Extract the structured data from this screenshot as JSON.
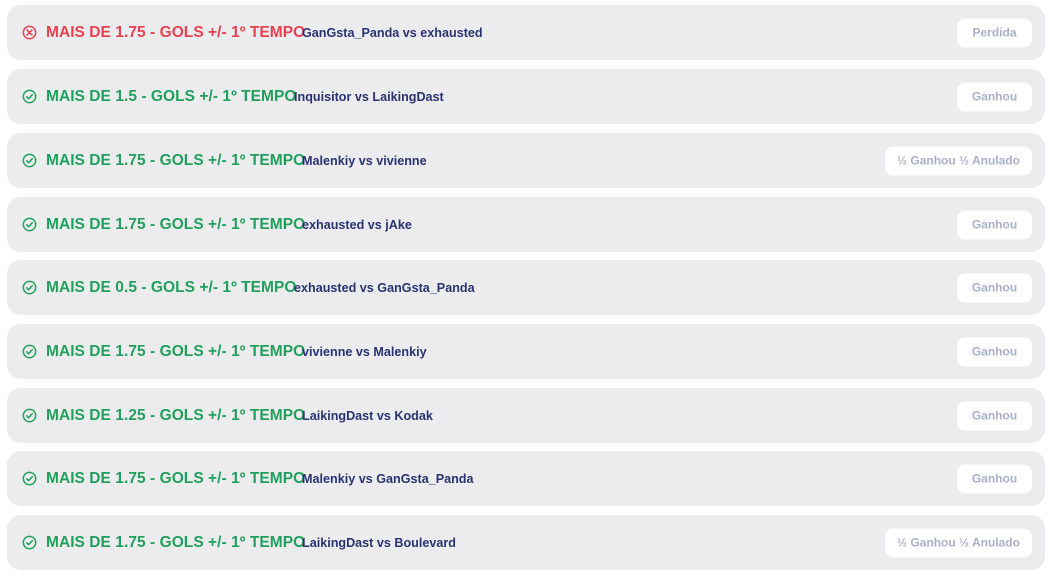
{
  "colors": {
    "win": "#21a05c",
    "loss": "#e8414f",
    "match_text": "#2a3270",
    "badge_text": "#a9b0c8",
    "row_bg": "#ececef"
  },
  "bets": [
    {
      "status": "loss",
      "status_icon": "x-circle-icon",
      "market": "MAIS DE 1.75 - GOLS +/- 1º TEMPO",
      "match": "GanGsta_Panda vs exhausted",
      "result": "Perdida"
    },
    {
      "status": "win",
      "status_icon": "check-circle-icon",
      "market": "MAIS DE 1.5 - GOLS +/- 1º TEMPO",
      "match": "Inquisitor vs LaikingDast",
      "result": "Ganhou"
    },
    {
      "status": "win",
      "status_icon": "check-circle-icon",
      "market": "MAIS DE 1.75 - GOLS +/- 1º TEMPO",
      "match": "Malenkiy vs vivienne",
      "result": "½ Ganhou ½ Anulado"
    },
    {
      "status": "win",
      "status_icon": "check-circle-icon",
      "market": "MAIS DE 1.75 - GOLS +/- 1º TEMPO",
      "match": "exhausted vs jAke",
      "result": "Ganhou"
    },
    {
      "status": "win",
      "status_icon": "check-circle-icon",
      "market": "MAIS DE 0.5 - GOLS +/- 1º TEMPO",
      "match": "exhausted vs GanGsta_Panda",
      "result": "Ganhou"
    },
    {
      "status": "win",
      "status_icon": "check-circle-icon",
      "market": "MAIS DE 1.75 - GOLS +/- 1º TEMPO",
      "match": "vivienne vs Malenkiy",
      "result": "Ganhou"
    },
    {
      "status": "win",
      "status_icon": "check-circle-icon",
      "market": "MAIS DE 1.25 - GOLS +/- 1º TEMPO",
      "match": "LaikingDast vs Kodak",
      "result": "Ganhou"
    },
    {
      "status": "win",
      "status_icon": "check-circle-icon",
      "market": "MAIS DE 1.75 - GOLS +/- 1º TEMPO",
      "match": "Malenkiy vs GanGsta_Panda",
      "result": "Ganhou"
    },
    {
      "status": "win",
      "status_icon": "check-circle-icon",
      "market": "MAIS DE 1.75 - GOLS +/- 1º TEMPO",
      "match": "LaikingDast vs Boulevard",
      "result": "½ Ganhou ½ Anulado"
    }
  ]
}
